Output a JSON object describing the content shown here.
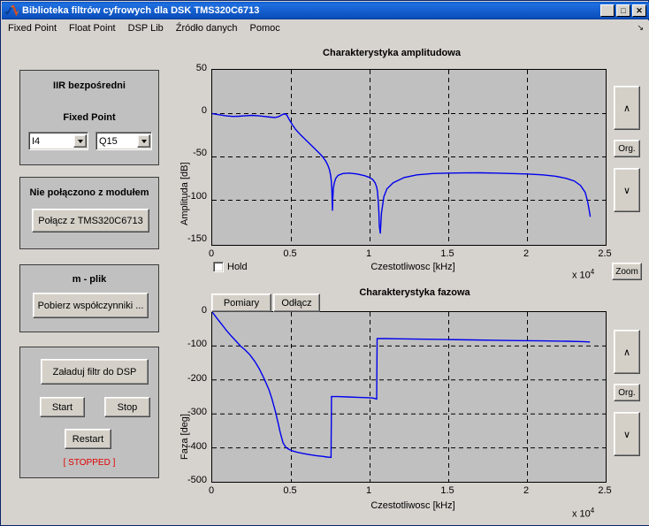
{
  "window": {
    "title": "Biblioteka filtrów cyfrowych dla DSK TMS320C6713",
    "icon": "matlab-icon",
    "buttons": {
      "minimize": "_",
      "maximize": "□",
      "close": "✕"
    },
    "titlebar_color": "#0a50bc"
  },
  "menubar": {
    "items": [
      {
        "label": "Fixed Point",
        "name": "menu-fixed-point"
      },
      {
        "label": "Float Point",
        "name": "menu-float-point"
      },
      {
        "label": "DSP Lib",
        "name": "menu-dsp-lib"
      },
      {
        "label": "Źródło danych",
        "name": "menu-zrodlo-danych"
      },
      {
        "label": "Pomoc",
        "name": "menu-pomoc"
      }
    ],
    "overflow_arrow": "↘"
  },
  "panels": {
    "filter": {
      "title_1": "IIR bezpośredni",
      "title_2": "Fixed Point",
      "combo_input": {
        "value": "I4",
        "name": "input-format-combo"
      },
      "combo_coeff": {
        "value": "Q15",
        "name": "coefficient-format-combo"
      }
    },
    "connection": {
      "title": "Nie połączono z modułem",
      "connect_button": "Połącz z TMS320C6713"
    },
    "mfile": {
      "title": "m - plik",
      "load_button": "Pobierz współczynniki ..."
    },
    "control": {
      "upload_button": "Załaduj filtr do DSP",
      "start_button": "Start",
      "stop_button": "Stop",
      "restart_button": "Restart",
      "status": "[ STOPPED ]",
      "status_color": "#e00000"
    }
  },
  "plot_controls": {
    "hold_checkbox": {
      "label": "Hold",
      "checked": false
    },
    "measure_button": "Pomiary",
    "disconnect_button": "Odłącz",
    "zoom_button": "Zoom",
    "amp_up_button": "∧",
    "amp_org_button": "Org.",
    "amp_down_button": "∨",
    "phase_up_button": "∧",
    "phase_org_button": "Org.",
    "phase_down_button": "∨"
  },
  "chart_data": [
    {
      "type": "line",
      "name": "amplitude-response",
      "title": "Charakterystyka amplitudowa",
      "xlabel": "Czestotliwosc  [kHz]",
      "ylabel": "Amplituda  [dB]",
      "x_exponent": "x 10",
      "x_exponent_power": "4",
      "xlim": [
        0,
        2.5
      ],
      "ylim": [
        -150,
        50
      ],
      "xticks": [
        0,
        0.5,
        1,
        1.5,
        2,
        2.5
      ],
      "xtick_labels": [
        "0",
        "0.5",
        "1",
        "1.5",
        "2",
        "2.5"
      ],
      "yticks": [
        -150,
        -100,
        -50,
        0,
        50
      ],
      "ytick_labels": [
        "-150",
        "-100",
        "-50",
        "0",
        "50"
      ],
      "grid": true,
      "line_color": "#0000ee",
      "series": [
        {
          "name": "magnitude_dB",
          "x": [
            0,
            0.04,
            0.09,
            0.13,
            0.17,
            0.21,
            0.25,
            0.29,
            0.33,
            0.37,
            0.4,
            0.42,
            0.44,
            0.455,
            0.465,
            0.475,
            0.49,
            0.51,
            0.53,
            0.56,
            0.6,
            0.64,
            0.68,
            0.7,
            0.72,
            0.735,
            0.745,
            0.752,
            0.757,
            0.76,
            0.762,
            0.764,
            0.766,
            0.77,
            0.775,
            0.785,
            0.8,
            0.83,
            0.87,
            0.92,
            0.97,
            1.0,
            1.02,
            1.035,
            1.045,
            1.05,
            1.053,
            1.056,
            1.059,
            1.062,
            1.068,
            1.075,
            1.09,
            1.11,
            1.15,
            1.22,
            1.3,
            1.4,
            1.5,
            1.6,
            1.7,
            1.8,
            1.9,
            2.0,
            2.1,
            2.18,
            2.25,
            2.3,
            2.34,
            2.37,
            2.385,
            2.395,
            2.4
          ],
          "y": [
            0,
            -1.2,
            -2.6,
            -3.2,
            -3.0,
            -2.4,
            -2.0,
            -2.4,
            -3.2,
            -4.0,
            -4.4,
            -3.6,
            -1.6,
            -0.5,
            -0.4,
            -2.0,
            -7.0,
            -13.0,
            -18.0,
            -24.0,
            -31.0,
            -38.0,
            -45.0,
            -49.0,
            -54.0,
            -59.0,
            -64.0,
            -70.0,
            -77.0,
            -86.0,
            -97.0,
            -111.0,
            -97.0,
            -86.0,
            -80.0,
            -74.0,
            -70.5,
            -68.5,
            -68.0,
            -69.0,
            -71.0,
            -73.0,
            -75.5,
            -79.0,
            -84.0,
            -89.0,
            -95.0,
            -102.0,
            -112.0,
            -128.0,
            -137.0,
            -114.0,
            -95.0,
            -86.0,
            -79.0,
            -73.0,
            -70.0,
            -68.5,
            -68.0,
            -67.8,
            -67.7,
            -68.0,
            -68.5,
            -69.0,
            -70.0,
            -71.5,
            -74.0,
            -77.0,
            -82.0,
            -90.0,
            -100.0,
            -110.0,
            -118.0
          ]
        }
      ]
    },
    {
      "type": "line",
      "name": "phase-response",
      "title": "Charakterystyka fazowa",
      "xlabel": "Czestotliwosc  [kHz]",
      "ylabel": "Faza  [deg]",
      "x_exponent": "x 10",
      "x_exponent_power": "4",
      "xlim": [
        0,
        2.5
      ],
      "ylim": [
        -500,
        0
      ],
      "xticks": [
        0,
        0.5,
        1,
        1.5,
        2,
        2.5
      ],
      "xtick_labels": [
        "0",
        "0.5",
        "1",
        "1.5",
        "2",
        "2.5"
      ],
      "yticks": [
        -500,
        -400,
        -300,
        -200,
        -100,
        0
      ],
      "ytick_labels": [
        "-500",
        "-400",
        "-300",
        "-200",
        "-100",
        "0"
      ],
      "grid": true,
      "line_color": "#0000ee",
      "series": [
        {
          "name": "phase_deg",
          "x": [
            0,
            0.03,
            0.06,
            0.09,
            0.12,
            0.15,
            0.18,
            0.21,
            0.24,
            0.27,
            0.3,
            0.33,
            0.36,
            0.38,
            0.4,
            0.42,
            0.43,
            0.44,
            0.45,
            0.46,
            0.47,
            0.49,
            0.51,
            0.54,
            0.58,
            0.62,
            0.66,
            0.7,
            0.73,
            0.755,
            0.758,
            0.8,
            0.86,
            0.92,
            0.98,
            1.02,
            1.045,
            1.048,
            1.1,
            1.2,
            1.35,
            1.5,
            1.65,
            1.8,
            1.95,
            2.1,
            2.25,
            2.35,
            2.4
          ],
          "y": [
            0,
            -18,
            -36,
            -54,
            -70,
            -85,
            -100,
            -112,
            -126,
            -145,
            -168,
            -196,
            -228,
            -256,
            -290,
            -330,
            -350,
            -368,
            -385,
            -393,
            -399,
            -405,
            -409,
            -413,
            -417,
            -420,
            -423,
            -425,
            -427,
            -428,
            -249,
            -249,
            -250,
            -251,
            -252,
            -253,
            -256,
            -78,
            -78,
            -79,
            -80,
            -81,
            -82,
            -83,
            -84,
            -85,
            -86,
            -87,
            -88
          ]
        }
      ]
    }
  ]
}
